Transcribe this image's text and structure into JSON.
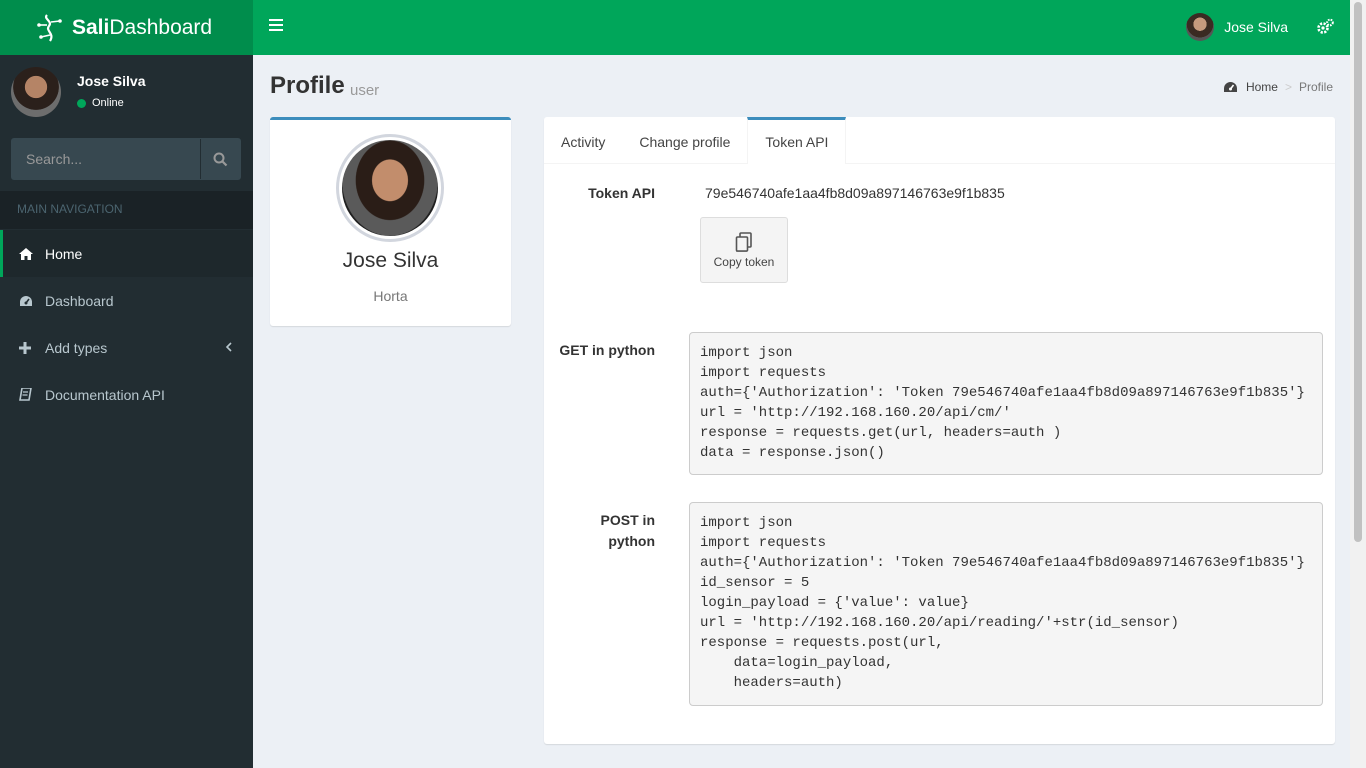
{
  "app": {
    "brand_bold": "Sali",
    "brand_rest": "Dashboard",
    "nav_user_name": "Jose Silva",
    "accent_color": "#00a65a",
    "sidebar_color": "#222d32"
  },
  "sidebar": {
    "user_name": "Jose Silva",
    "status": "Online",
    "search_placeholder": "Search...",
    "nav_header": "MAIN NAVIGATION",
    "items": [
      {
        "label": "Home",
        "icon": "home-icon",
        "active": true
      },
      {
        "label": "Dashboard",
        "icon": "dashboard-icon"
      },
      {
        "label": "Add types",
        "icon": "plus-icon"
      },
      {
        "label": "Documentation API",
        "icon": "book-icon"
      }
    ]
  },
  "header": {
    "title": "Profile",
    "subtitle": "user",
    "breadcrumb": [
      "Home",
      "Profile"
    ]
  },
  "profile": {
    "name": "Jose Silva",
    "role": "Horta"
  },
  "tabs": [
    "Activity",
    "Change profile",
    "Token API"
  ],
  "active_tab": "Token API",
  "token": {
    "label": "Token API",
    "value": "79e546740afe1aa4fb8d09a897146763e9f1b835",
    "copy_label": "Copy token"
  },
  "examples": {
    "get_label": "GET in python",
    "get_code": "import json\nimport requests\nauth={'Authorization': 'Token 79e546740afe1aa4fb8d09a897146763e9f1b835'}\nurl = 'http://192.168.160.20/api/cm/'\nresponse = requests.get(url, headers=auth )\ndata = response.json()",
    "post_label_line1": "POST in",
    "post_label_line2": "python",
    "post_code": "import json\nimport requests\nauth={'Authorization': 'Token 79e546740afe1aa4fb8d09a897146763e9f1b835'}\nid_sensor = 5\nlogin_payload = {'value': value}\nurl = 'http://192.168.160.20/api/reading/'+str(id_sensor)\nresponse = requests.post(url,\n    data=login_payload,\n    headers=auth)"
  }
}
